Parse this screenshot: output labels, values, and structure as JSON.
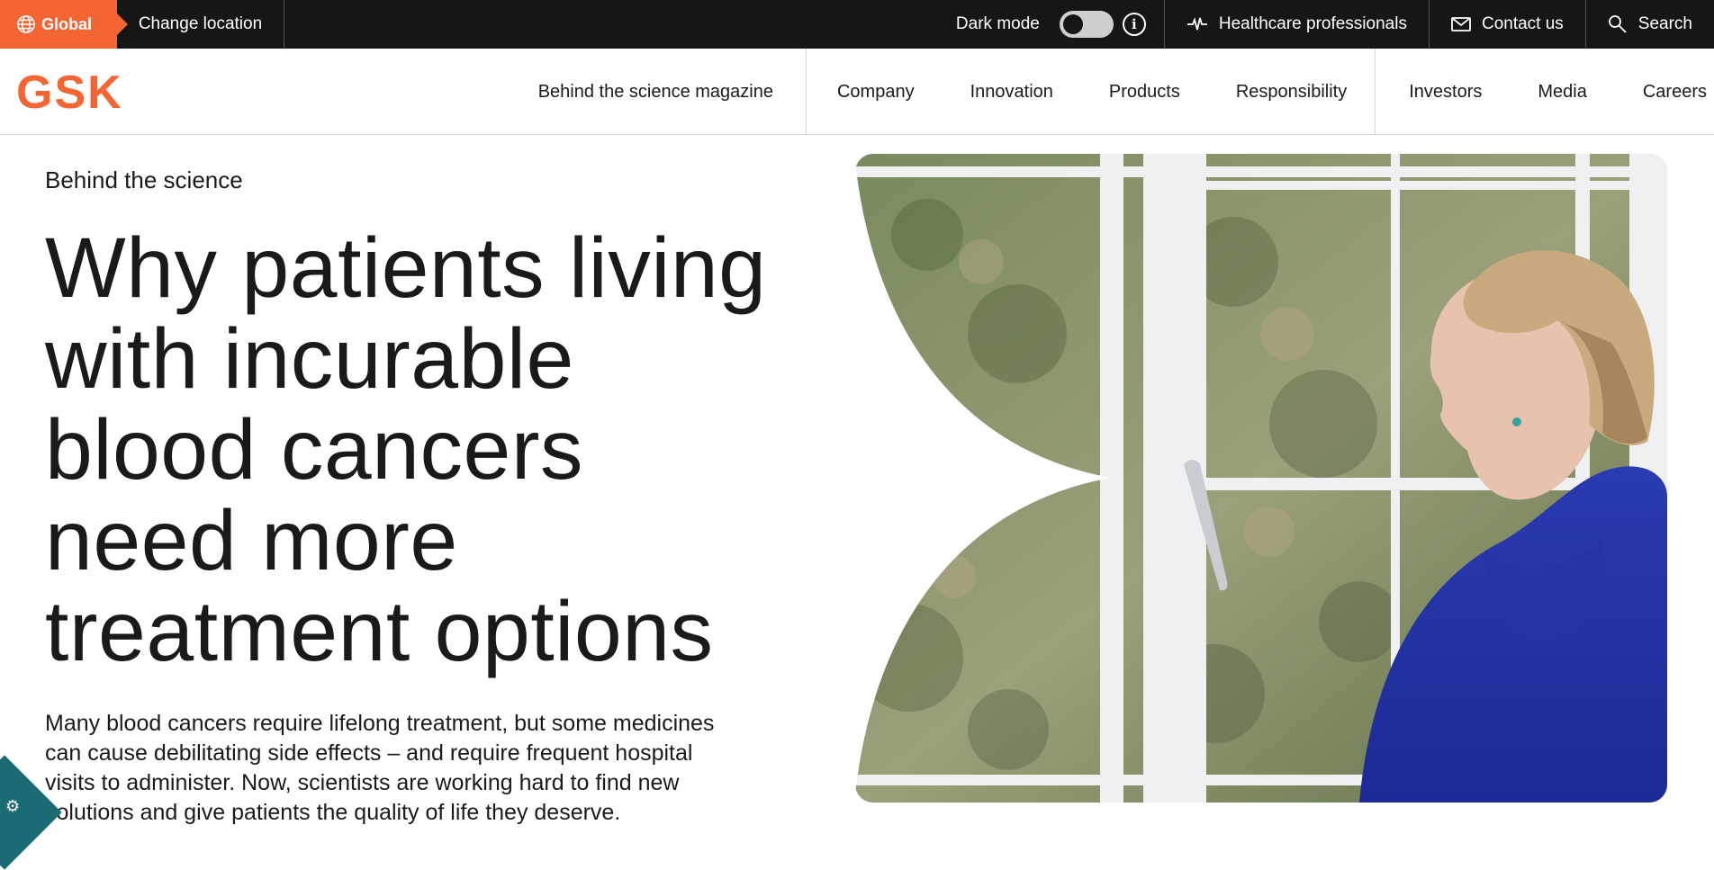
{
  "utility": {
    "global_label": "Global",
    "change_location": "Change location",
    "dark_mode_label": "Dark mode",
    "info_symbol": "i",
    "healthcare_professionals": "Healthcare professionals",
    "contact_us": "Contact us",
    "search": "Search"
  },
  "brand": {
    "logo_text": "GSK",
    "accent": "#f36633"
  },
  "nav": {
    "items": [
      "Behind the science magazine",
      "Company",
      "Innovation",
      "Products",
      "Responsibility",
      "Investors",
      "Media",
      "Careers"
    ]
  },
  "hero": {
    "eyebrow": "Behind the science",
    "headline_lines": [
      "Why patients living",
      "with incurable",
      "blood cancers",
      "need more",
      "treatment options"
    ],
    "intro_lines": [
      "Many blood cancers require lifelong treatment, but some medicines",
      "can cause debilitating side effects – and require frequent hospital",
      "visits to administer. Now, scientists are working hard to find new",
      "solutions and give patients the quality of life they deserve."
    ]
  },
  "icons": {
    "globe": "globe-icon",
    "info": "info-icon",
    "pulse": "heartbeat-icon",
    "mail": "envelope-icon",
    "search": "search-icon",
    "cookie": "gear-icon"
  }
}
